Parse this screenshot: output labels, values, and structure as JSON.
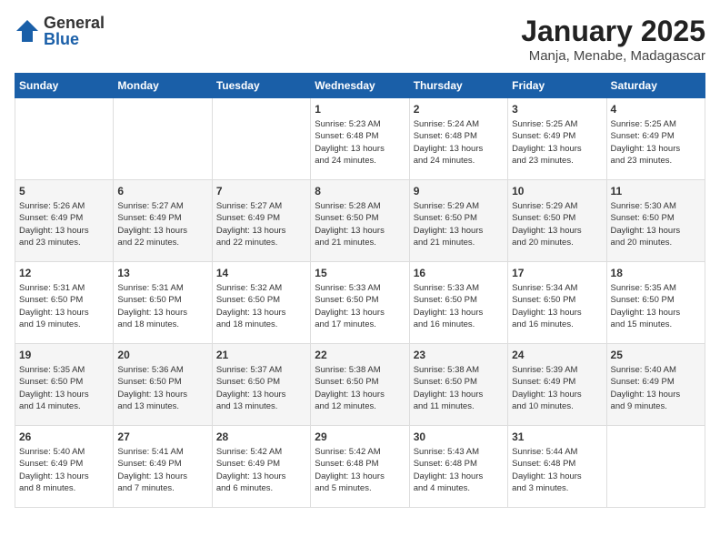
{
  "logo": {
    "general": "General",
    "blue": "Blue"
  },
  "title": "January 2025",
  "location": "Manja, Menabe, Madagascar",
  "days_of_week": [
    "Sunday",
    "Monday",
    "Tuesday",
    "Wednesday",
    "Thursday",
    "Friday",
    "Saturday"
  ],
  "weeks": [
    [
      {
        "day": "",
        "info": ""
      },
      {
        "day": "",
        "info": ""
      },
      {
        "day": "",
        "info": ""
      },
      {
        "day": "1",
        "info": "Sunrise: 5:23 AM\nSunset: 6:48 PM\nDaylight: 13 hours\nand 24 minutes."
      },
      {
        "day": "2",
        "info": "Sunrise: 5:24 AM\nSunset: 6:48 PM\nDaylight: 13 hours\nand 24 minutes."
      },
      {
        "day": "3",
        "info": "Sunrise: 5:25 AM\nSunset: 6:49 PM\nDaylight: 13 hours\nand 23 minutes."
      },
      {
        "day": "4",
        "info": "Sunrise: 5:25 AM\nSunset: 6:49 PM\nDaylight: 13 hours\nand 23 minutes."
      }
    ],
    [
      {
        "day": "5",
        "info": "Sunrise: 5:26 AM\nSunset: 6:49 PM\nDaylight: 13 hours\nand 23 minutes."
      },
      {
        "day": "6",
        "info": "Sunrise: 5:27 AM\nSunset: 6:49 PM\nDaylight: 13 hours\nand 22 minutes."
      },
      {
        "day": "7",
        "info": "Sunrise: 5:27 AM\nSunset: 6:49 PM\nDaylight: 13 hours\nand 22 minutes."
      },
      {
        "day": "8",
        "info": "Sunrise: 5:28 AM\nSunset: 6:50 PM\nDaylight: 13 hours\nand 21 minutes."
      },
      {
        "day": "9",
        "info": "Sunrise: 5:29 AM\nSunset: 6:50 PM\nDaylight: 13 hours\nand 21 minutes."
      },
      {
        "day": "10",
        "info": "Sunrise: 5:29 AM\nSunset: 6:50 PM\nDaylight: 13 hours\nand 20 minutes."
      },
      {
        "day": "11",
        "info": "Sunrise: 5:30 AM\nSunset: 6:50 PM\nDaylight: 13 hours\nand 20 minutes."
      }
    ],
    [
      {
        "day": "12",
        "info": "Sunrise: 5:31 AM\nSunset: 6:50 PM\nDaylight: 13 hours\nand 19 minutes."
      },
      {
        "day": "13",
        "info": "Sunrise: 5:31 AM\nSunset: 6:50 PM\nDaylight: 13 hours\nand 18 minutes."
      },
      {
        "day": "14",
        "info": "Sunrise: 5:32 AM\nSunset: 6:50 PM\nDaylight: 13 hours\nand 18 minutes."
      },
      {
        "day": "15",
        "info": "Sunrise: 5:33 AM\nSunset: 6:50 PM\nDaylight: 13 hours\nand 17 minutes."
      },
      {
        "day": "16",
        "info": "Sunrise: 5:33 AM\nSunset: 6:50 PM\nDaylight: 13 hours\nand 16 minutes."
      },
      {
        "day": "17",
        "info": "Sunrise: 5:34 AM\nSunset: 6:50 PM\nDaylight: 13 hours\nand 16 minutes."
      },
      {
        "day": "18",
        "info": "Sunrise: 5:35 AM\nSunset: 6:50 PM\nDaylight: 13 hours\nand 15 minutes."
      }
    ],
    [
      {
        "day": "19",
        "info": "Sunrise: 5:35 AM\nSunset: 6:50 PM\nDaylight: 13 hours\nand 14 minutes."
      },
      {
        "day": "20",
        "info": "Sunrise: 5:36 AM\nSunset: 6:50 PM\nDaylight: 13 hours\nand 13 minutes."
      },
      {
        "day": "21",
        "info": "Sunrise: 5:37 AM\nSunset: 6:50 PM\nDaylight: 13 hours\nand 13 minutes."
      },
      {
        "day": "22",
        "info": "Sunrise: 5:38 AM\nSunset: 6:50 PM\nDaylight: 13 hours\nand 12 minutes."
      },
      {
        "day": "23",
        "info": "Sunrise: 5:38 AM\nSunset: 6:50 PM\nDaylight: 13 hours\nand 11 minutes."
      },
      {
        "day": "24",
        "info": "Sunrise: 5:39 AM\nSunset: 6:49 PM\nDaylight: 13 hours\nand 10 minutes."
      },
      {
        "day": "25",
        "info": "Sunrise: 5:40 AM\nSunset: 6:49 PM\nDaylight: 13 hours\nand 9 minutes."
      }
    ],
    [
      {
        "day": "26",
        "info": "Sunrise: 5:40 AM\nSunset: 6:49 PM\nDaylight: 13 hours\nand 8 minutes."
      },
      {
        "day": "27",
        "info": "Sunrise: 5:41 AM\nSunset: 6:49 PM\nDaylight: 13 hours\nand 7 minutes."
      },
      {
        "day": "28",
        "info": "Sunrise: 5:42 AM\nSunset: 6:49 PM\nDaylight: 13 hours\nand 6 minutes."
      },
      {
        "day": "29",
        "info": "Sunrise: 5:42 AM\nSunset: 6:48 PM\nDaylight: 13 hours\nand 5 minutes."
      },
      {
        "day": "30",
        "info": "Sunrise: 5:43 AM\nSunset: 6:48 PM\nDaylight: 13 hours\nand 4 minutes."
      },
      {
        "day": "31",
        "info": "Sunrise: 5:44 AM\nSunset: 6:48 PM\nDaylight: 13 hours\nand 3 minutes."
      },
      {
        "day": "",
        "info": ""
      }
    ]
  ]
}
